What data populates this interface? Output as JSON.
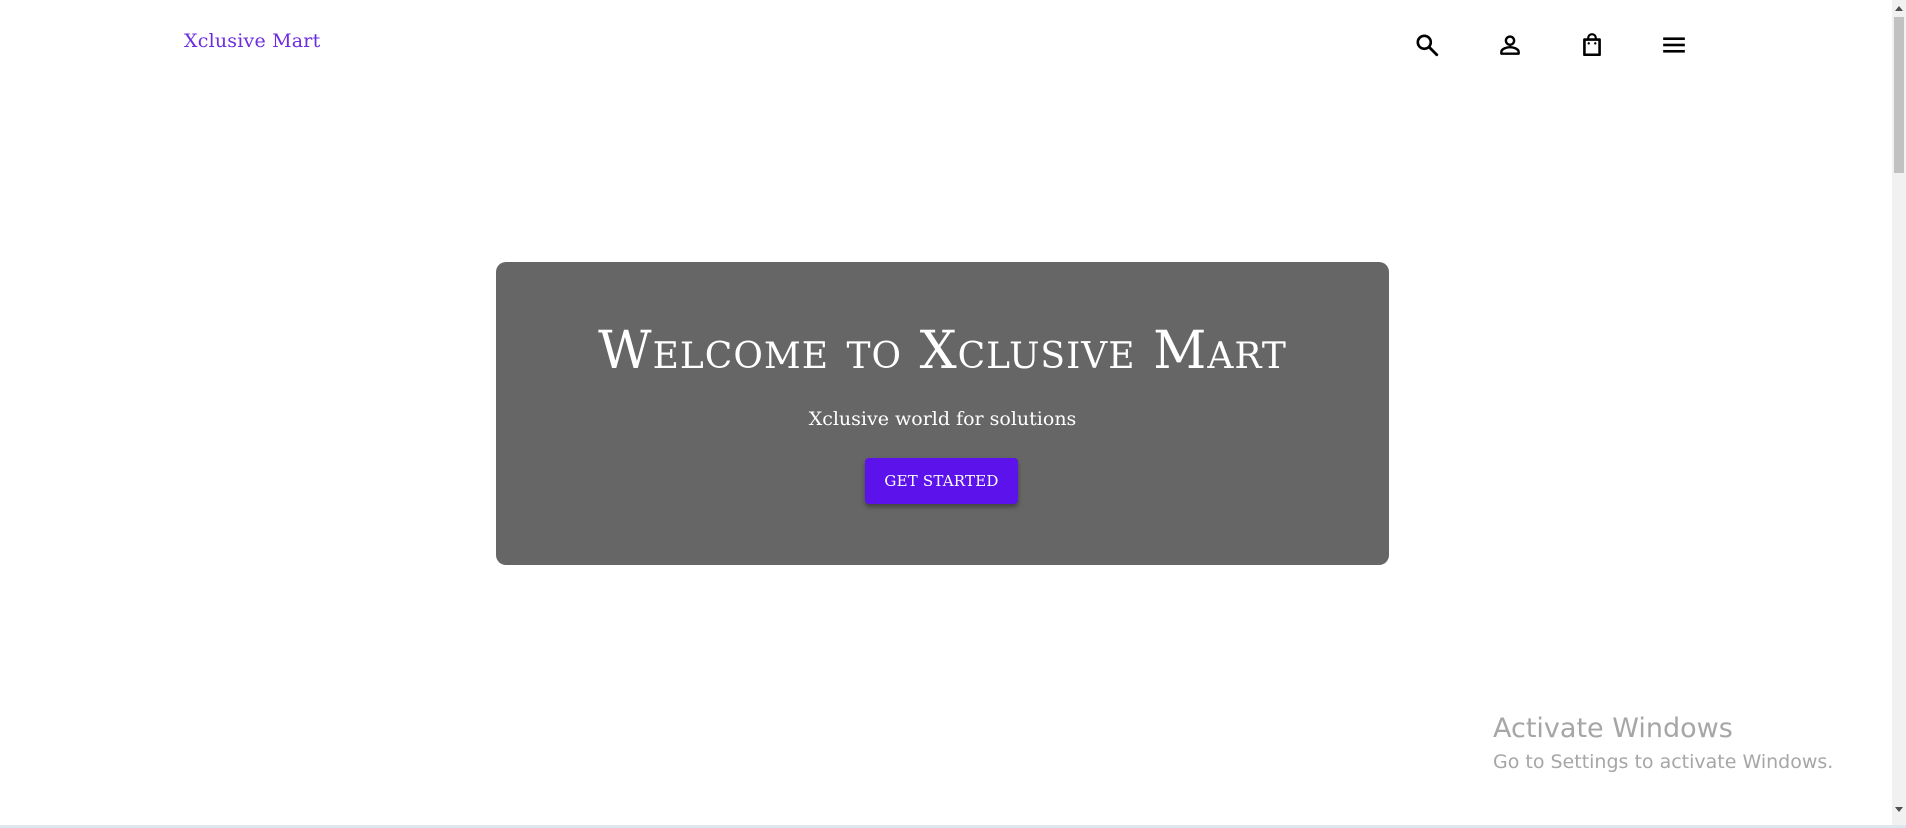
{
  "header": {
    "brand": "Xclusive Mart",
    "brand_color": "#6d2ce0",
    "icons": [
      "search-icon",
      "account-icon",
      "shopping-bag-icon",
      "menu-icon"
    ]
  },
  "hero": {
    "title": "Welcome to Xclusive Mart",
    "subtitle": "Xclusive world for solutions",
    "button_label": "GET STARTED",
    "background_color": "#666666",
    "button_color": "#5b12eb"
  },
  "watermark": {
    "title": "Activate Windows",
    "subtitle": "Go to Settings to activate Windows."
  }
}
